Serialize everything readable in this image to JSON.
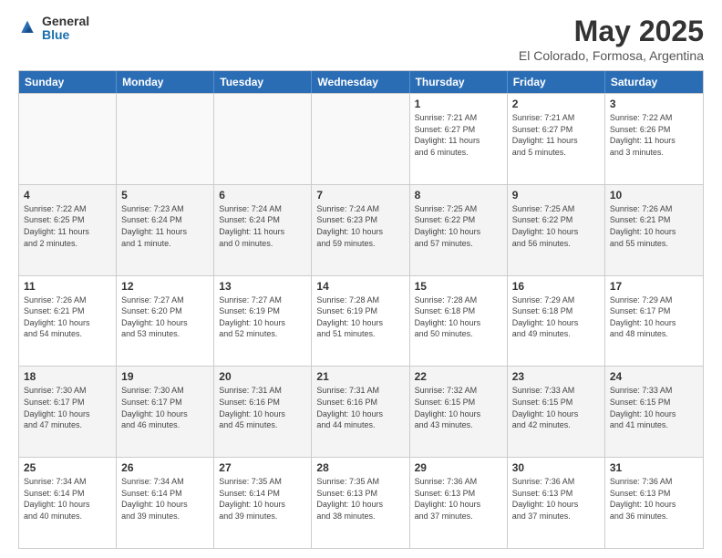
{
  "header": {
    "logo_general": "General",
    "logo_blue": "Blue",
    "title": "May 2025",
    "subtitle": "El Colorado, Formosa, Argentina"
  },
  "days_of_week": [
    "Sunday",
    "Monday",
    "Tuesday",
    "Wednesday",
    "Thursday",
    "Friday",
    "Saturday"
  ],
  "rows": [
    [
      {
        "day": "",
        "info": ""
      },
      {
        "day": "",
        "info": ""
      },
      {
        "day": "",
        "info": ""
      },
      {
        "day": "",
        "info": ""
      },
      {
        "day": "1",
        "info": "Sunrise: 7:21 AM\nSunset: 6:27 PM\nDaylight: 11 hours\nand 6 minutes."
      },
      {
        "day": "2",
        "info": "Sunrise: 7:21 AM\nSunset: 6:27 PM\nDaylight: 11 hours\nand 5 minutes."
      },
      {
        "day": "3",
        "info": "Sunrise: 7:22 AM\nSunset: 6:26 PM\nDaylight: 11 hours\nand 3 minutes."
      }
    ],
    [
      {
        "day": "4",
        "info": "Sunrise: 7:22 AM\nSunset: 6:25 PM\nDaylight: 11 hours\nand 2 minutes."
      },
      {
        "day": "5",
        "info": "Sunrise: 7:23 AM\nSunset: 6:24 PM\nDaylight: 11 hours\nand 1 minute."
      },
      {
        "day": "6",
        "info": "Sunrise: 7:24 AM\nSunset: 6:24 PM\nDaylight: 11 hours\nand 0 minutes."
      },
      {
        "day": "7",
        "info": "Sunrise: 7:24 AM\nSunset: 6:23 PM\nDaylight: 10 hours\nand 59 minutes."
      },
      {
        "day": "8",
        "info": "Sunrise: 7:25 AM\nSunset: 6:22 PM\nDaylight: 10 hours\nand 57 minutes."
      },
      {
        "day": "9",
        "info": "Sunrise: 7:25 AM\nSunset: 6:22 PM\nDaylight: 10 hours\nand 56 minutes."
      },
      {
        "day": "10",
        "info": "Sunrise: 7:26 AM\nSunset: 6:21 PM\nDaylight: 10 hours\nand 55 minutes."
      }
    ],
    [
      {
        "day": "11",
        "info": "Sunrise: 7:26 AM\nSunset: 6:21 PM\nDaylight: 10 hours\nand 54 minutes."
      },
      {
        "day": "12",
        "info": "Sunrise: 7:27 AM\nSunset: 6:20 PM\nDaylight: 10 hours\nand 53 minutes."
      },
      {
        "day": "13",
        "info": "Sunrise: 7:27 AM\nSunset: 6:19 PM\nDaylight: 10 hours\nand 52 minutes."
      },
      {
        "day": "14",
        "info": "Sunrise: 7:28 AM\nSunset: 6:19 PM\nDaylight: 10 hours\nand 51 minutes."
      },
      {
        "day": "15",
        "info": "Sunrise: 7:28 AM\nSunset: 6:18 PM\nDaylight: 10 hours\nand 50 minutes."
      },
      {
        "day": "16",
        "info": "Sunrise: 7:29 AM\nSunset: 6:18 PM\nDaylight: 10 hours\nand 49 minutes."
      },
      {
        "day": "17",
        "info": "Sunrise: 7:29 AM\nSunset: 6:17 PM\nDaylight: 10 hours\nand 48 minutes."
      }
    ],
    [
      {
        "day": "18",
        "info": "Sunrise: 7:30 AM\nSunset: 6:17 PM\nDaylight: 10 hours\nand 47 minutes."
      },
      {
        "day": "19",
        "info": "Sunrise: 7:30 AM\nSunset: 6:17 PM\nDaylight: 10 hours\nand 46 minutes."
      },
      {
        "day": "20",
        "info": "Sunrise: 7:31 AM\nSunset: 6:16 PM\nDaylight: 10 hours\nand 45 minutes."
      },
      {
        "day": "21",
        "info": "Sunrise: 7:31 AM\nSunset: 6:16 PM\nDaylight: 10 hours\nand 44 minutes."
      },
      {
        "day": "22",
        "info": "Sunrise: 7:32 AM\nSunset: 6:15 PM\nDaylight: 10 hours\nand 43 minutes."
      },
      {
        "day": "23",
        "info": "Sunrise: 7:33 AM\nSunset: 6:15 PM\nDaylight: 10 hours\nand 42 minutes."
      },
      {
        "day": "24",
        "info": "Sunrise: 7:33 AM\nSunset: 6:15 PM\nDaylight: 10 hours\nand 41 minutes."
      }
    ],
    [
      {
        "day": "25",
        "info": "Sunrise: 7:34 AM\nSunset: 6:14 PM\nDaylight: 10 hours\nand 40 minutes."
      },
      {
        "day": "26",
        "info": "Sunrise: 7:34 AM\nSunset: 6:14 PM\nDaylight: 10 hours\nand 39 minutes."
      },
      {
        "day": "27",
        "info": "Sunrise: 7:35 AM\nSunset: 6:14 PM\nDaylight: 10 hours\nand 39 minutes."
      },
      {
        "day": "28",
        "info": "Sunrise: 7:35 AM\nSunset: 6:13 PM\nDaylight: 10 hours\nand 38 minutes."
      },
      {
        "day": "29",
        "info": "Sunrise: 7:36 AM\nSunset: 6:13 PM\nDaylight: 10 hours\nand 37 minutes."
      },
      {
        "day": "30",
        "info": "Sunrise: 7:36 AM\nSunset: 6:13 PM\nDaylight: 10 hours\nand 37 minutes."
      },
      {
        "day": "31",
        "info": "Sunrise: 7:36 AM\nSunset: 6:13 PM\nDaylight: 10 hours\nand 36 minutes."
      }
    ]
  ]
}
